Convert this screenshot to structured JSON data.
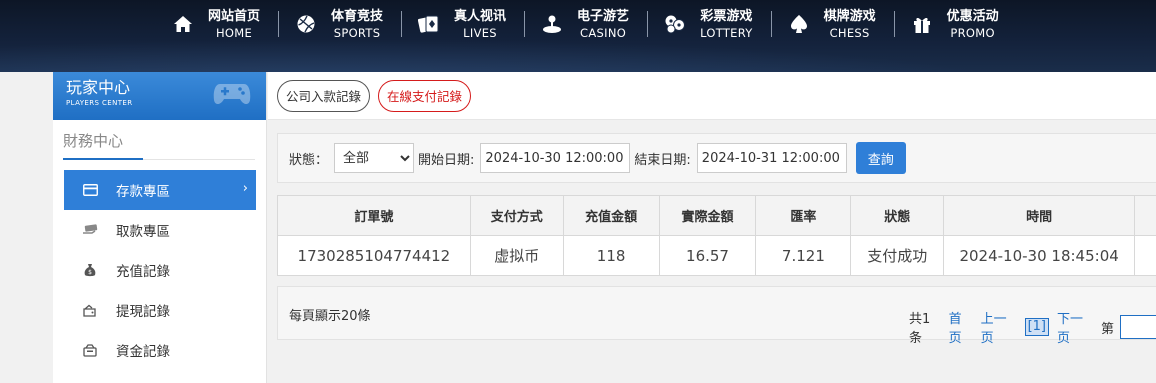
{
  "nav": {
    "items": [
      {
        "cn": "网站首页",
        "en": "HOME",
        "icon": "home-icon"
      },
      {
        "cn": "体育竞技",
        "en": "SPORTS",
        "icon": "ball-icon"
      },
      {
        "cn": "真人视讯",
        "en": "LIVES",
        "icon": "cards-icon"
      },
      {
        "cn": "电子游艺",
        "en": "CASINO",
        "icon": "joystick-icon"
      },
      {
        "cn": "彩票游戏",
        "en": "LOTTERY",
        "icon": "lottery-balls-icon"
      },
      {
        "cn": "棋牌游戏",
        "en": "CHESS",
        "icon": "spade-icon"
      },
      {
        "cn": "优惠活动",
        "en": "PROMO",
        "icon": "gift-icon"
      }
    ]
  },
  "sidebar": {
    "title": "玩家中心",
    "subtitle": "PLAYERS CENTER",
    "section": "財務中心",
    "items": [
      {
        "label": "存款專區",
        "icon": "card-icon",
        "active": true
      },
      {
        "label": "取款專區",
        "icon": "cash-icon"
      },
      {
        "label": "充值記錄",
        "icon": "money-bag-icon"
      },
      {
        "label": "提現記錄",
        "icon": "wallet-out-icon"
      },
      {
        "label": "資金記錄",
        "icon": "funds-icon"
      }
    ]
  },
  "tabs": [
    {
      "label": "公司入款記錄"
    },
    {
      "label": "在線支付記錄",
      "active": true
    }
  ],
  "filter": {
    "status_label": "狀態：",
    "status_value": "全部",
    "start_label": "開始日期:",
    "start_value": "2024-10-30 12:00:00",
    "end_label": "結束日期:",
    "end_value": "2024-10-31 12:00:00",
    "query_button": "查詢"
  },
  "table": {
    "headers": [
      "訂單號",
      "支付方式",
      "充值金額",
      "實際金額",
      "匯率",
      "狀態",
      "時間"
    ],
    "rows": [
      [
        "1730285104774412",
        "虚拟币",
        "118",
        "16.57",
        "7.121",
        "支付成功",
        "2024-10-30 18:45:04"
      ]
    ]
  },
  "pager": {
    "per_page": "每頁顯示20條",
    "total": "共1条",
    "first": "首页",
    "prev": "上一页",
    "current": "[1]",
    "next": "下一页",
    "goto": "第"
  },
  "colors": {
    "accent": "#2f7fd8",
    "danger": "#d51b1b"
  }
}
